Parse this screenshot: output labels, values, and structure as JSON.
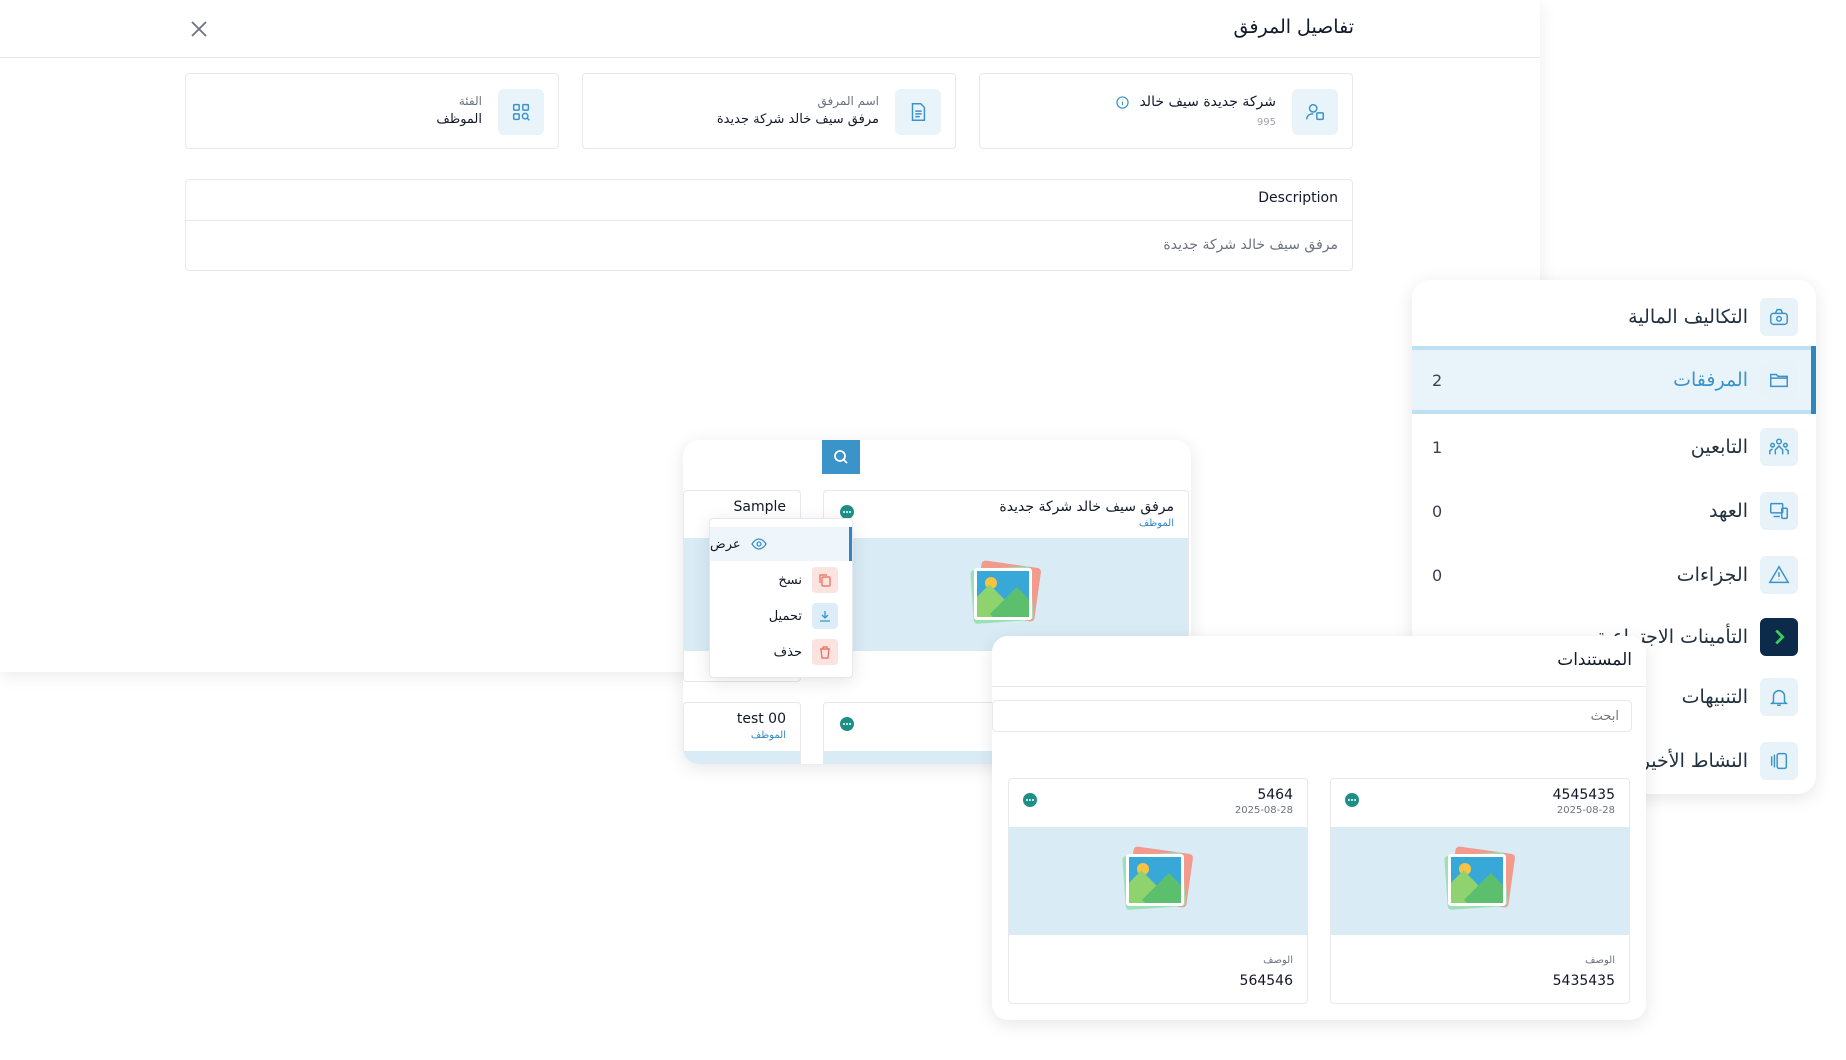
{
  "details_modal": {
    "title": "تفاصيل المرفق",
    "owner": {
      "name": "شركة جديدة سيف خالد",
      "code": "995"
    },
    "attachment_name": {
      "label": "اسم المرفق",
      "value": "مرفق سيف خالد شركة جديدة"
    },
    "category": {
      "label": "الفئة",
      "value": "الموظف"
    },
    "description": {
      "label": "Description",
      "value": "مرفق سيف خالد شركة جديدة"
    }
  },
  "sidebar": {
    "items": [
      {
        "label": "التكاليف المالية",
        "count": ""
      },
      {
        "label": "المرفقات",
        "count": "2"
      },
      {
        "label": "التابعين",
        "count": "1"
      },
      {
        "label": "العهد",
        "count": "0"
      },
      {
        "label": "الجزاءات",
        "count": "0"
      },
      {
        "label": "التأمينات الاجتماعية",
        "count": ""
      },
      {
        "label": "التنبيهات",
        "count": ""
      },
      {
        "label": "النشاط الأخير",
        "count": ""
      }
    ]
  },
  "attachments_panel": {
    "cards": [
      {
        "title": "مرفق سيف خالد شركة جديدة",
        "subtitle": "الموظف"
      },
      {
        "title": "Sample",
        "subtitle": ""
      },
      {
        "title": "test 00",
        "subtitle": "الموظف"
      }
    ],
    "menu": {
      "view": "عرض",
      "copy": "نسخ",
      "download": "تحميل",
      "delete": "حذف"
    }
  },
  "documents_panel": {
    "title": "المستندات",
    "search_placeholder": "ابحث",
    "cards": [
      {
        "title": "4545435",
        "date": "2025-08-28",
        "desc_label": "الوصف",
        "desc_value": "5435435"
      },
      {
        "title": "5464",
        "date": "2025-08-28",
        "desc_label": "الوصف",
        "desc_value": "564546"
      }
    ]
  },
  "colors": {
    "accent": "#3a93c9",
    "dots": "#1f8f84",
    "highlight": "#e9f3fa"
  }
}
